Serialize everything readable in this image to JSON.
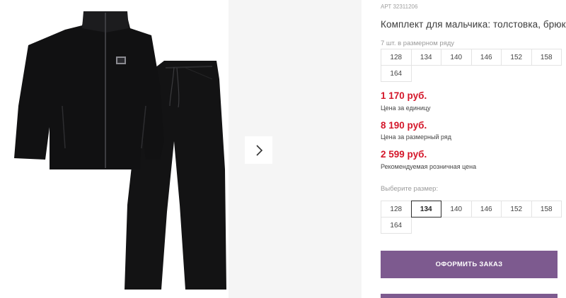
{
  "product": {
    "sku_label": "АРТ",
    "sku": "32311206",
    "title": "Комплект для мальчика: толстовка, брюки",
    "image_alt": "black-tracksuit-jacket-and-pants"
  },
  "pack": {
    "note": "7 шт. в размерном ряду",
    "sizes": [
      "128",
      "134",
      "140",
      "146",
      "152",
      "158",
      "164"
    ]
  },
  "prices": [
    {
      "value": "1 170 руб.",
      "label": "Цена за единицу"
    },
    {
      "value": "8 190 руб.",
      "label": "Цена за размерный ряд"
    },
    {
      "value": "2 599 руб.",
      "label": "Рекомендуемая розничная цена"
    }
  ],
  "size_select": {
    "label": "Выберите размер:",
    "sizes": [
      "128",
      "134",
      "140",
      "146",
      "152",
      "158",
      "164"
    ],
    "selected": "134"
  },
  "actions": {
    "order_label": "ОФОРМИТЬ ЗАКАЗ"
  },
  "colors": {
    "accent": "#7d5a8f",
    "price": "#d4172a"
  }
}
